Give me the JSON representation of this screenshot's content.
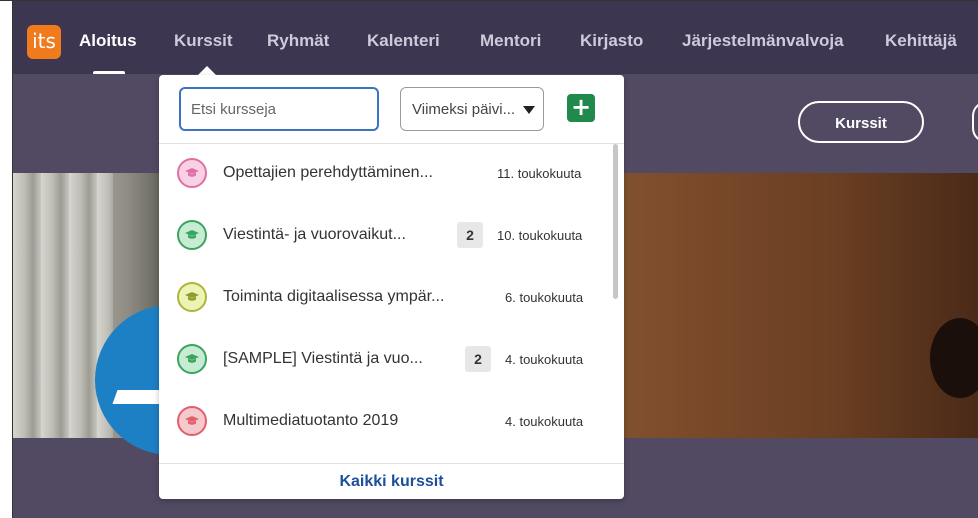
{
  "nav": {
    "logo": "its",
    "items": [
      {
        "label": "Aloitus"
      },
      {
        "label": "Kurssit"
      },
      {
        "label": "Ryhmät"
      },
      {
        "label": "Kalenteri"
      },
      {
        "label": "Mentori"
      },
      {
        "label": "Kirjasto"
      },
      {
        "label": "Järjestelmänvalvoja"
      },
      {
        "label": "Kehittäjä"
      }
    ],
    "active": "Aloitus"
  },
  "hero": {
    "button_label": "Kurssit"
  },
  "dropdown": {
    "search_placeholder": "Etsi kursseja",
    "sort_label": "Viimeksi päivi...",
    "add_label": "+",
    "courses": [
      {
        "title": "Opettajien perehdyttäminen...",
        "date": "11. toukokuuta",
        "color": "pink"
      },
      {
        "title": "Viestintä- ja vuorovaikut...",
        "count": "2",
        "date": "10. toukokuuta",
        "color": "green"
      },
      {
        "title": "Toiminta digitaalisessa ympär...",
        "date": "6. toukokuuta",
        "color": "yellow"
      },
      {
        "title": "[SAMPLE] Viestintä ja vuo...",
        "count": "2",
        "date": "4. toukokuuta",
        "color": "green"
      },
      {
        "title": "Multimediatuotanto 2019",
        "date": "4. toukokuuta",
        "color": "red"
      }
    ],
    "footer_link": "Kaikki kurssit"
  },
  "colors": {
    "nav_bg": "#3d3650",
    "accent_blue": "#3a74c2",
    "add_green": "#1f8a4c",
    "link_blue": "#1c4f9c",
    "icon_pink": "#e26ea6",
    "icon_green": "#3aa55d",
    "icon_yellow": "#a9b83a",
    "icon_red": "#e0606a"
  }
}
